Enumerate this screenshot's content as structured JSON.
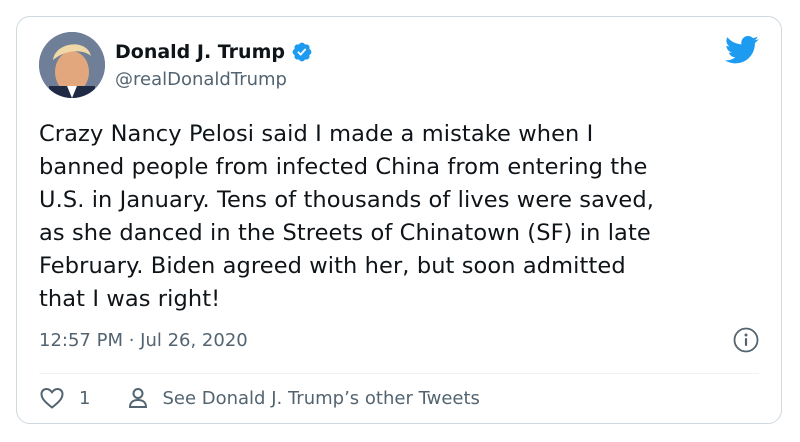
{
  "author": {
    "name": "Donald J. Trump",
    "handle": "@realDonaldTrump",
    "verified": true
  },
  "tweet": {
    "text": "Crazy Nancy Pelosi said I made a mistake when I\nbanned people from infected China from entering the\nU.S. in January. Tens of thousands of lives were saved,\nas she danced in the Streets of Chinatown (SF) in late\nFebruary. Biden agreed with her, but soon admitted\nthat I was right!",
    "timestamp": "12:57 PM · Jul 26, 2020"
  },
  "actions": {
    "like_count": "1",
    "see_more_label": "See Donald J. Trump’s other Tweets"
  },
  "icons": {
    "brand": "twitter-bird-icon",
    "verified": "verified-badge-icon",
    "info": "info-icon",
    "like": "heart-icon",
    "profile": "person-icon"
  },
  "colors": {
    "twitter_blue": "#1d9bf0",
    "text": "#0f1419",
    "secondary_text": "#536471",
    "border": "#cfd9de"
  }
}
